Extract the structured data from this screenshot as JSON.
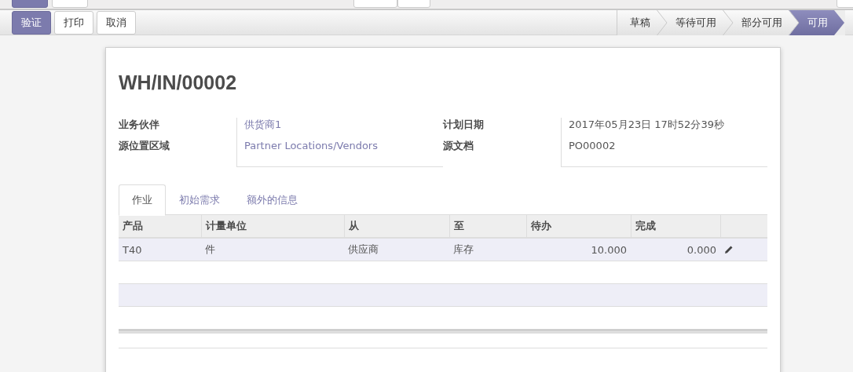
{
  "actions": [
    {
      "label": "验证",
      "primary": true
    },
    {
      "label": "打印",
      "primary": false
    },
    {
      "label": "取消",
      "primary": false
    }
  ],
  "stages": [
    {
      "label": "草稿",
      "selected": false
    },
    {
      "label": "等待可用",
      "selected": false
    },
    {
      "label": "部分可用",
      "selected": false
    },
    {
      "label": "可用",
      "selected": true
    }
  ],
  "record": {
    "title": "WH/IN/00002",
    "fields_left": [
      {
        "label": "业务伙伴",
        "value": "供货商1",
        "kind": "link"
      },
      {
        "label": "源位置区域",
        "value": "Partner Locations/Vendors",
        "kind": "link"
      }
    ],
    "fields_right": [
      {
        "label": "计划日期",
        "value": "2017年05月23日 17时52分39秒",
        "kind": "text"
      },
      {
        "label": "源文档",
        "value": "PO00002",
        "kind": "text"
      }
    ],
    "tabs": [
      {
        "label": "作业",
        "selected": true
      },
      {
        "label": "初始需求",
        "selected": false
      },
      {
        "label": "额外的信息",
        "selected": false
      }
    ],
    "table": {
      "columns": [
        {
          "label": "产品",
          "kind": "text"
        },
        {
          "label": "计量单位",
          "kind": "text"
        },
        {
          "label": "从",
          "kind": "text"
        },
        {
          "label": "至",
          "kind": "text"
        },
        {
          "label": "待办",
          "kind": "number"
        },
        {
          "label": "完成",
          "kind": "number"
        }
      ],
      "rows": [
        {
          "cells": [
            "T40",
            "件",
            "供应商",
            "库存",
            "10.000",
            "0.000"
          ],
          "editable": true
        }
      ]
    }
  }
}
